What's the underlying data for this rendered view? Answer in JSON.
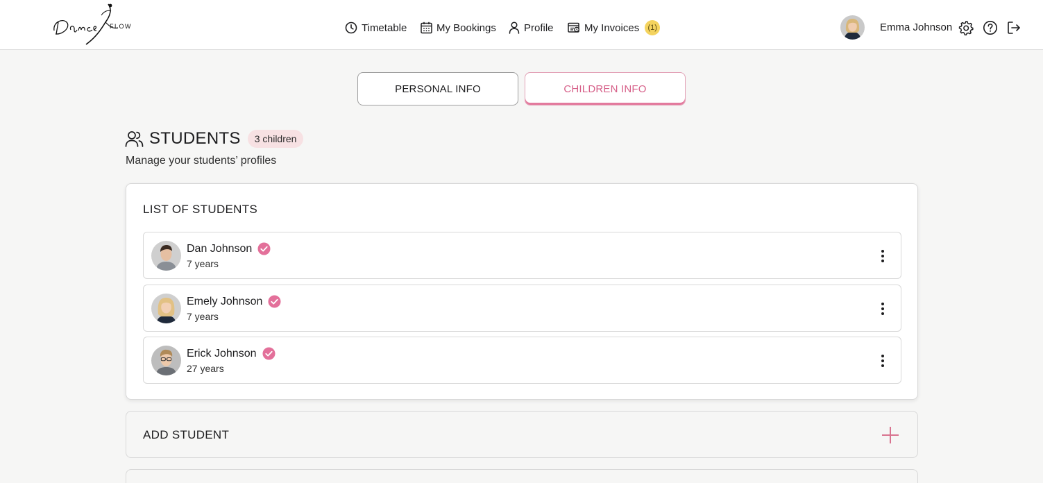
{
  "header": {
    "nav": [
      {
        "label": "Timetable",
        "icon": "clock-icon"
      },
      {
        "label": "My Bookings",
        "icon": "calendar-icon"
      },
      {
        "label": "Profile",
        "icon": "person-icon"
      },
      {
        "label": "My Invoices",
        "icon": "invoice-icon",
        "badge": "(1)"
      }
    ],
    "user_name": "Emma Johnson"
  },
  "tabs": {
    "personal": "PERSONAL INFO",
    "children": "CHILDREN INFO",
    "active": "children"
  },
  "students_section": {
    "title": "STUDENTS",
    "count_badge": "3 children",
    "subtitle": "Manage your students’ profiles"
  },
  "list": {
    "title": "LIST OF STUDENTS",
    "students": [
      {
        "name": "Dan Johnson",
        "age": "7 years",
        "verified": true
      },
      {
        "name": "Emely Johnson",
        "age": "7 years",
        "verified": true
      },
      {
        "name": "Erick Johnson",
        "age": "27 years",
        "verified": true
      }
    ]
  },
  "add_student": {
    "label": "ADD STUDENT"
  },
  "colors": {
    "accent": "#e3709a",
    "invoice_badge": "#f4d35e",
    "count_badge_bg": "#f7e1e3",
    "background": "#f6f6f5"
  }
}
